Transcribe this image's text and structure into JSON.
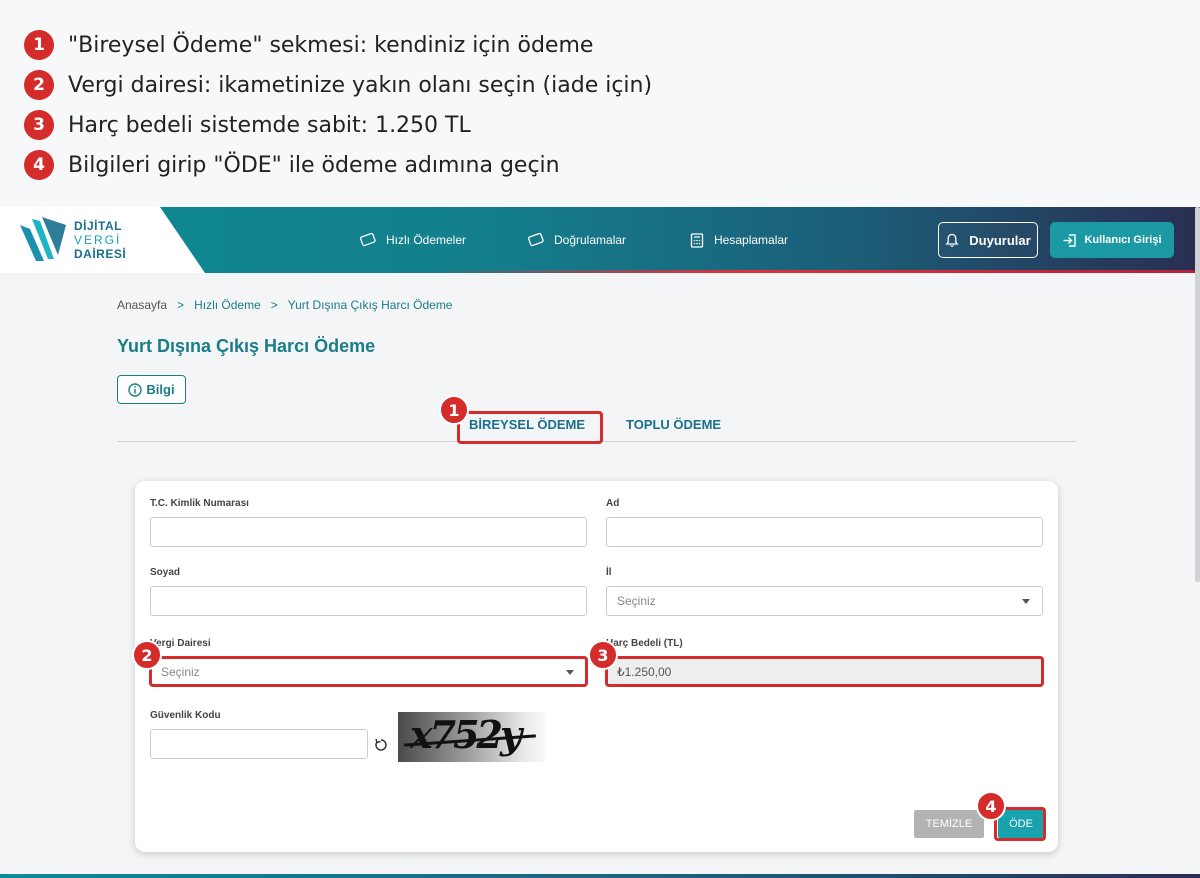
{
  "instructions": [
    {
      "num": "1",
      "text": "\"Bireysel Ödeme\" sekmesi: kendiniz için ödeme"
    },
    {
      "num": "2",
      "text": "Vergi dairesi: ikametinize yakın olanı seçin (iade için)"
    },
    {
      "num": "3",
      "text": "Harç bedeli sistemde sabit: 1.250 TL"
    },
    {
      "num": "4",
      "text": "Bilgileri girip \"ÖDE\" ile ödeme adımına geçin"
    }
  ],
  "header": {
    "logo": {
      "line1": "DİJİTAL",
      "line2": "VERGİ",
      "line3": "DAİRESİ"
    },
    "nav": [
      "Hızlı Ödemeler",
      "Doğrulamalar",
      "Hesaplamalar"
    ],
    "announcements": "Duyurular",
    "login": "Kullanıcı Girişi"
  },
  "breadcrumb": [
    "Anasayfa",
    "Hızlı Ödeme",
    "Yurt Dışına Çıkış Harcı Ödeme"
  ],
  "breadcrumb_sep": ">",
  "page_title": "Yurt Dışına Çıkış Harcı Ödeme",
  "info_button": "Bilgi",
  "tabs": [
    "BİREYSEL ÖDEME",
    "TOPLU ÖDEME"
  ],
  "form": {
    "tc_label": "T.C. Kimlik Numarası",
    "tc_value": "",
    "ad_label": "Ad",
    "ad_value": "",
    "soyad_label": "Soyad",
    "soyad_value": "",
    "il_label": "İl",
    "il_placeholder": "Seçiniz",
    "vergi_label": "Vergi Dairesi",
    "vergi_placeholder": "Seçiniz",
    "harc_label": "Harç Bedeli (TL)",
    "harc_value": "₺1.250,00",
    "guvenlik_label": "Güvenlik Kodu",
    "guvenlik_value": "",
    "captcha_text": "x752y",
    "clear_button": "TEMİZLE",
    "pay_button": "ÖDE"
  },
  "badges": [
    "1",
    "2",
    "3",
    "4"
  ],
  "colors": {
    "accent": "#1a7d88",
    "highlight": "#d42b2b",
    "pay": "#17a2ad",
    "clear": "#b3b3b3"
  }
}
